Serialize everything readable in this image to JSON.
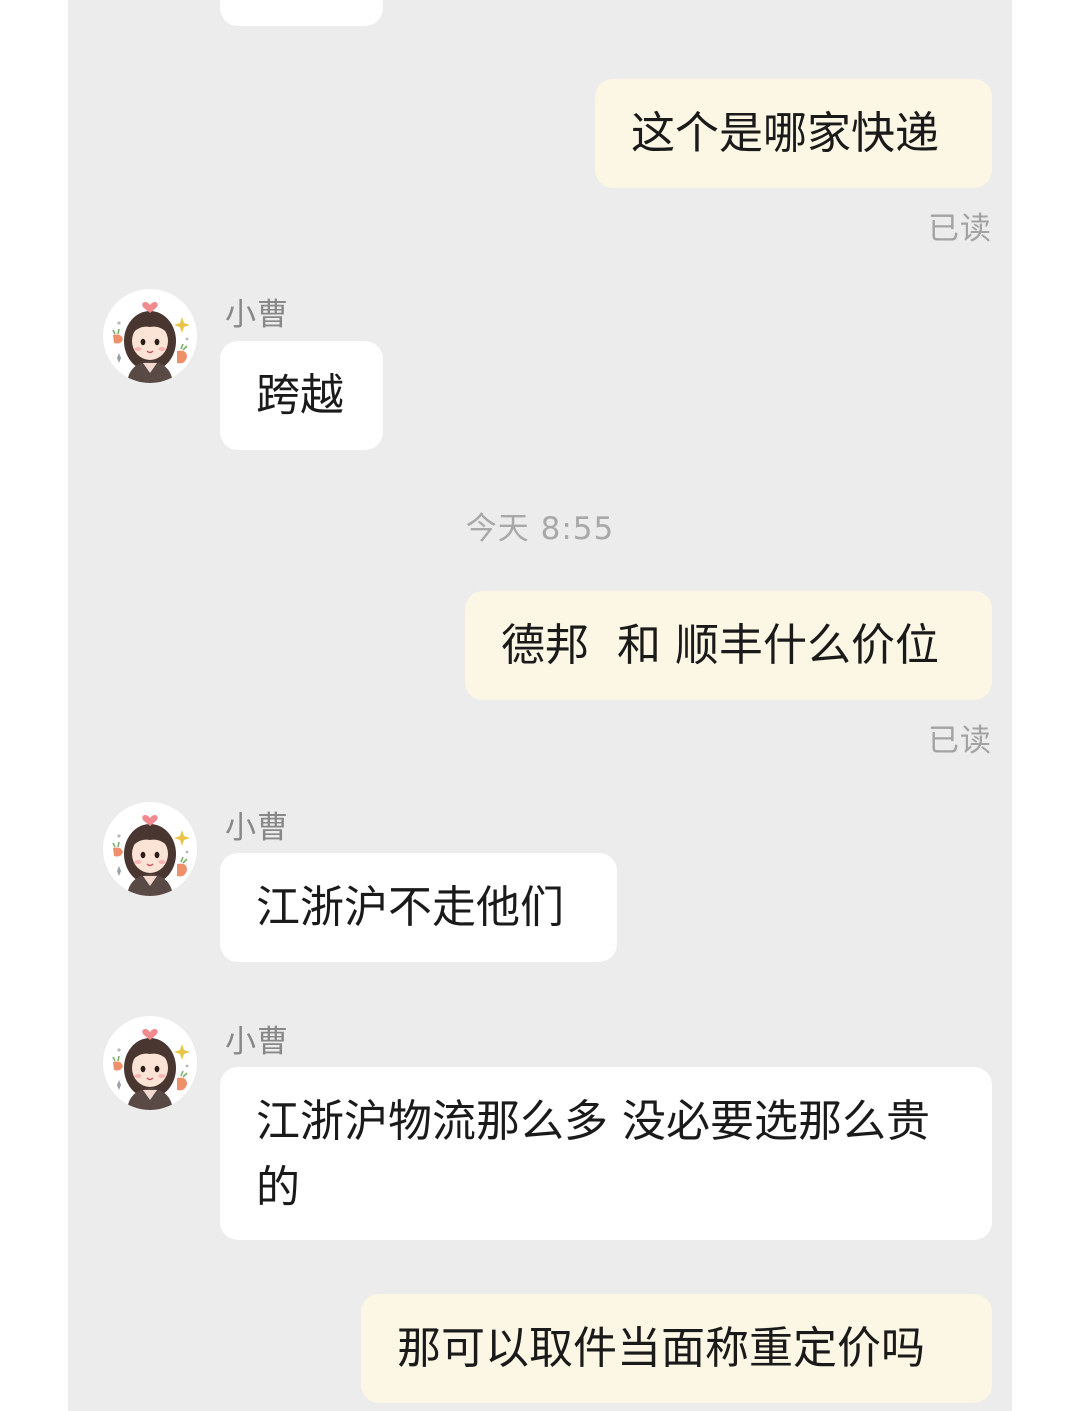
{
  "contact": {
    "name": "小曹"
  },
  "read_status": "已读",
  "timestamp": "今天 8:55",
  "messages": [
    {
      "side": "in",
      "text": ""
    },
    {
      "side": "out",
      "text": "这个是哪家快递",
      "status": "已读"
    },
    {
      "side": "in",
      "sender": "小曹",
      "text": "跨越"
    },
    {
      "side": "out",
      "text": "德邦  和 顺丰什么价位",
      "status": "已读"
    },
    {
      "side": "in",
      "sender": "小曹",
      "text": "江浙沪不走他们"
    },
    {
      "side": "in",
      "sender": "小曹",
      "text": "江浙沪物流那么多 没必要选那么贵的"
    },
    {
      "side": "out",
      "text": "那可以取件当面称重定价吗"
    }
  ],
  "colors": {
    "chat_background": "#ececec",
    "incoming_bubble": "#ffffff",
    "outgoing_bubble": "#fbf7e4",
    "meta_text": "#a3a3a3"
  },
  "icons": {
    "avatar": "cartoon-girl-avatar-icon"
  }
}
